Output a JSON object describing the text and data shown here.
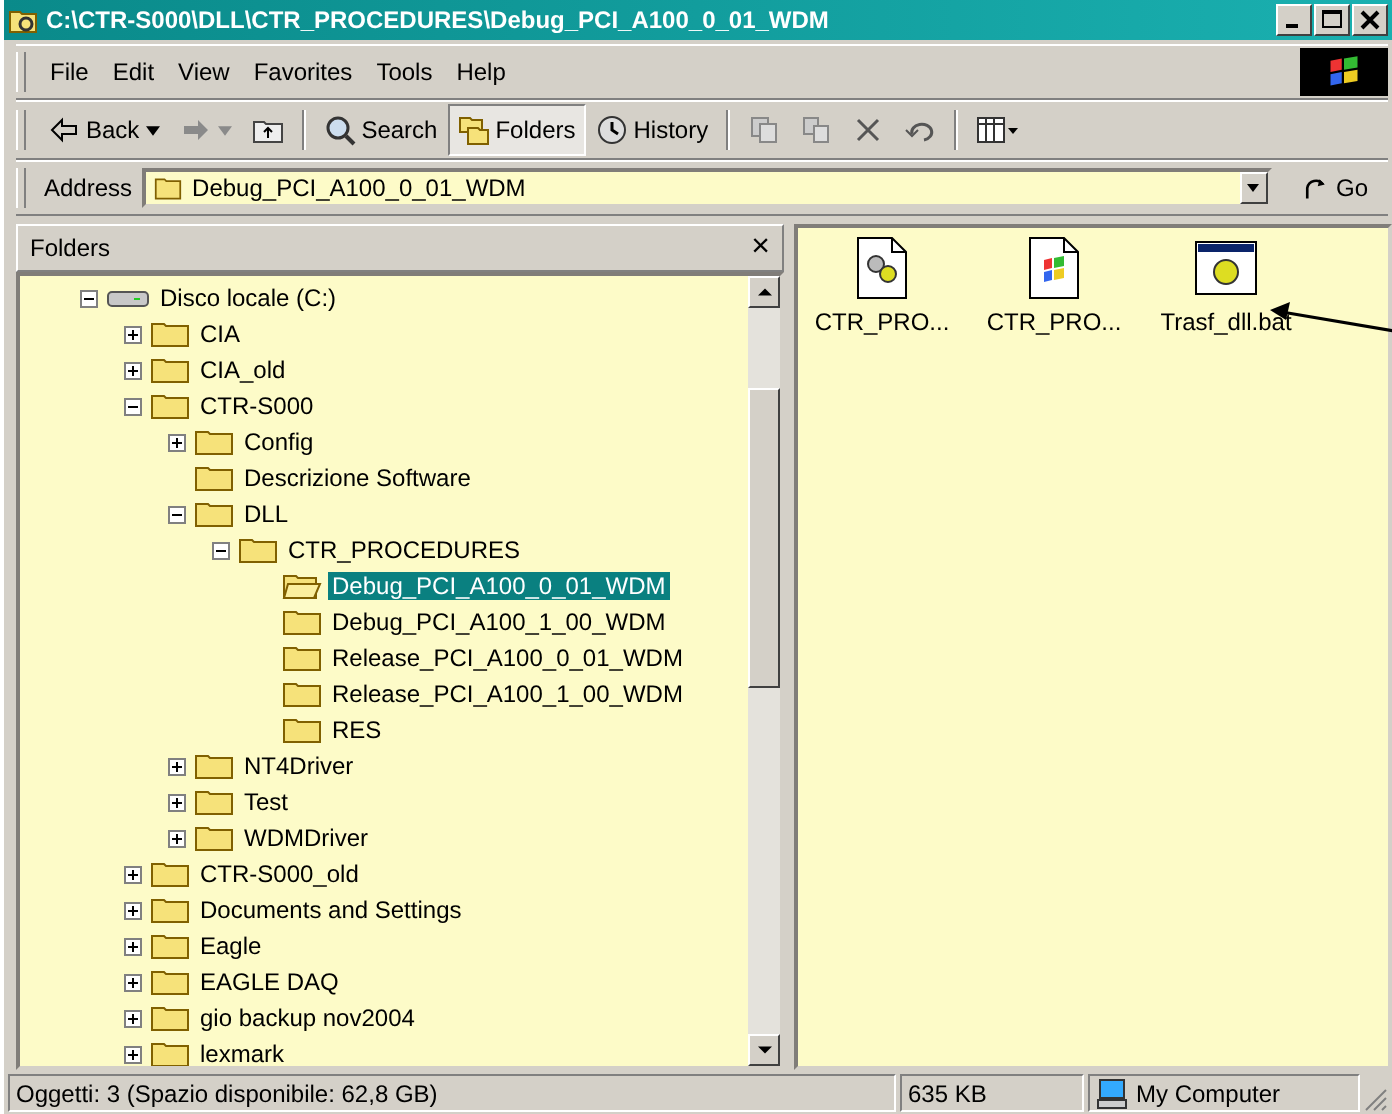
{
  "window": {
    "title": "C:\\CTR-S000\\DLL\\CTR_PROCEDURES\\Debug_PCI_A100_0_01_WDM"
  },
  "menu": [
    "File",
    "Edit",
    "View",
    "Favorites",
    "Tools",
    "Help"
  ],
  "toolbar": [
    {
      "kind": "back",
      "label": "Back",
      "selected": false
    },
    {
      "kind": "forward",
      "disabled": true,
      "selected": false
    },
    {
      "kind": "up",
      "selected": false
    },
    {
      "kind": "search",
      "label": "Search",
      "selected": false
    },
    {
      "kind": "folders",
      "label": "Folders",
      "selected": true
    },
    {
      "kind": "history",
      "label": "History",
      "selected": false
    },
    {
      "kind": "move",
      "selected": false
    },
    {
      "kind": "copy",
      "selected": false
    },
    {
      "kind": "delete",
      "selected": false
    },
    {
      "kind": "undo",
      "selected": false
    },
    {
      "kind": "views",
      "selected": false
    }
  ],
  "address": {
    "label": "Address",
    "value": "Debug_PCI_A100_0_01_WDM",
    "go": "Go"
  },
  "folders_pane": {
    "title": "Folders",
    "close": "×"
  },
  "tree": [
    {
      "label": "Disco locale (C:)",
      "kind": "drive",
      "expanded": true,
      "selected": false,
      "children": [
        {
          "label": "CIA",
          "kind": "folder",
          "expanded": false,
          "selected": false
        },
        {
          "label": "CIA_old",
          "kind": "folder",
          "expanded": false,
          "selected": false
        },
        {
          "label": "CTR-S000",
          "kind": "folder",
          "expanded": true,
          "selected": false,
          "children": [
            {
              "label": "Config",
              "kind": "folder",
              "expanded": false,
              "selected": false
            },
            {
              "label": "Descrizione Software",
              "kind": "folder",
              "selected": false
            },
            {
              "label": "DLL",
              "kind": "folder",
              "expanded": true,
              "selected": false,
              "children": [
                {
                  "label": "CTR_PROCEDURES",
                  "kind": "folder",
                  "expanded": true,
                  "selected": false,
                  "children": [
                    {
                      "label": "Debug_PCI_A100_0_01_WDM",
                      "kind": "open-folder",
                      "selected": true
                    },
                    {
                      "label": "Debug_PCI_A100_1_00_WDM",
                      "kind": "folder",
                      "selected": false
                    },
                    {
                      "label": "Release_PCI_A100_0_01_WDM",
                      "kind": "folder",
                      "selected": false
                    },
                    {
                      "label": "Release_PCI_A100_1_00_WDM",
                      "kind": "folder",
                      "selected": false
                    },
                    {
                      "label": "RES",
                      "kind": "folder",
                      "selected": false
                    }
                  ]
                }
              ]
            },
            {
              "label": "NT4Driver",
              "kind": "folder",
              "expanded": false,
              "selected": false
            },
            {
              "label": "Test",
              "kind": "folder",
              "expanded": false,
              "selected": false
            },
            {
              "label": "WDMDriver",
              "kind": "folder",
              "expanded": false,
              "selected": false
            }
          ]
        },
        {
          "label": "CTR-S000_old",
          "kind": "folder",
          "expanded": false,
          "selected": false
        },
        {
          "label": "Documents and Settings",
          "kind": "folder",
          "expanded": false,
          "selected": false
        },
        {
          "label": "Eagle",
          "kind": "folder",
          "expanded": false,
          "selected": false
        },
        {
          "label": "EAGLE DAQ",
          "kind": "folder",
          "expanded": false,
          "selected": false
        },
        {
          "label": "gio backup nov2004",
          "kind": "folder",
          "expanded": false,
          "selected": false
        },
        {
          "label": "lexmark",
          "kind": "folder",
          "expanded": false,
          "selected": false
        }
      ]
    }
  ],
  "files": [
    {
      "name": "CTR_PRO...",
      "kind": "gear-doc"
    },
    {
      "name": "CTR_PRO...",
      "kind": "win-doc"
    },
    {
      "name": "Trasf_dll.bat",
      "kind": "batch"
    }
  ],
  "status_bar": [
    "Oggetti: 3 (Spazio disponibile: 62,8 GB)",
    "635 KB",
    "My Computer"
  ]
}
